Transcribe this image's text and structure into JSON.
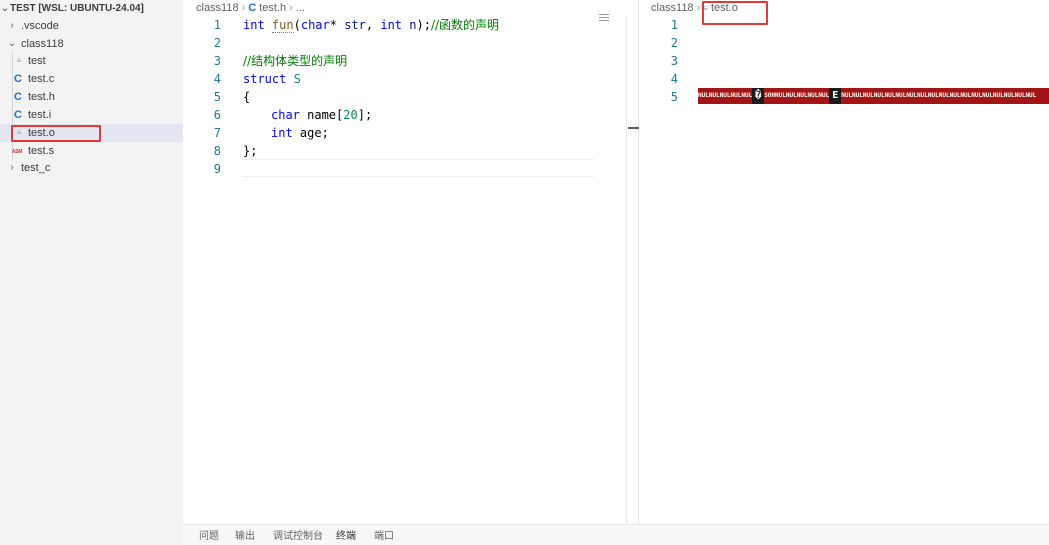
{
  "explorer": {
    "root_label": "TEST [WSL: UBUNTU-24.04]",
    "items": [
      {
        "label": ".vscode",
        "kind": "folder",
        "expanded": false
      },
      {
        "label": "class118",
        "kind": "folder",
        "expanded": true
      },
      {
        "label": "test",
        "kind": "file",
        "icon": "document-icon"
      },
      {
        "label": "test.c",
        "kind": "file",
        "icon": "c-file-icon"
      },
      {
        "label": "test.h",
        "kind": "file",
        "icon": "c-file-icon"
      },
      {
        "label": "test.i",
        "kind": "file",
        "icon": "c-file-icon"
      },
      {
        "label": "test.o",
        "kind": "file",
        "icon": "document-icon",
        "selected": true
      },
      {
        "label": "test.s",
        "kind": "file",
        "icon": "asm-file-icon"
      },
      {
        "label": "test_c",
        "kind": "folder",
        "expanded": false
      }
    ]
  },
  "left_editor": {
    "breadcrumb": {
      "folder": "class118",
      "file": "test.h",
      "tail": "..."
    },
    "line_numbers": [
      "1",
      "2",
      "3",
      "4",
      "5",
      "6",
      "7",
      "8",
      "9"
    ],
    "code": {
      "line1": {
        "kw": "int",
        "fn": "fun",
        "open": "(",
        "type": "char",
        "star": "*",
        "p1": " str",
        "comma": ", ",
        "kw2": "int",
        "p2": " n",
        "close": ");",
        "comment": "//函数的声明"
      },
      "line3": {
        "comment": "//结构体类型的声明"
      },
      "line4": {
        "kw": "struct",
        "name": "S"
      },
      "line5": {
        "text": "{"
      },
      "line6": {
        "type": "char",
        "rest1": " name[",
        "num": "20",
        "rest2": "];"
      },
      "line7": {
        "type": "int",
        "rest": " age;"
      },
      "line8": {
        "text": "};"
      }
    }
  },
  "right_editor": {
    "breadcrumb": {
      "folder": "class118",
      "file": "test.o"
    },
    "line_numbers": [
      "1",
      "2",
      "3",
      "4",
      "5"
    ],
    "binary_segments": [
      {
        "text": "NULNULNULNULNUL",
        "ctl": false
      },
      {
        "text": "�",
        "ctl": true
      },
      {
        "text": "SOHNULNULNULNULNUL",
        "ctl": false
      },
      {
        "text": "E",
        "ctl": true
      },
      {
        "text": "NULNULNULNULNULNULNULNULNULNULNULNULNULNULNULNULNULNUL",
        "ctl": false
      }
    ]
  },
  "panel": {
    "tabs": [
      "问题",
      "输出",
      "调试控制台",
      "终端",
      "端口"
    ],
    "active_tab": "终端"
  },
  "colors": {
    "highlight_box": "#e53935",
    "sidebar_bg": "#f3f3f3",
    "binary_bar": "#a31515"
  }
}
